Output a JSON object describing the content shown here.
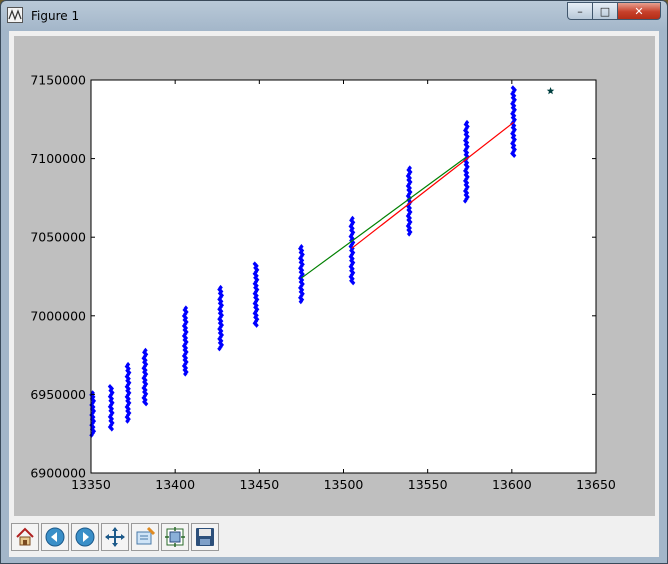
{
  "window": {
    "title": "Figure 1",
    "controls": {
      "minimize": "–",
      "maximize": "□",
      "close": "✕"
    }
  },
  "toolbar": {
    "buttons": [
      {
        "name": "home-button",
        "icon": "home-icon"
      },
      {
        "name": "back-button",
        "icon": "back-arrow-icon"
      },
      {
        "name": "forward-button",
        "icon": "forward-arrow-icon"
      },
      {
        "name": "pan-button",
        "icon": "pan-arrows-icon"
      },
      {
        "name": "zoom-button",
        "icon": "zoom-rect-icon"
      },
      {
        "name": "subplots-button",
        "icon": "subplots-icon"
      },
      {
        "name": "save-button",
        "icon": "save-disk-icon"
      }
    ]
  },
  "chart_data": {
    "type": "scatter",
    "title": "",
    "xlabel": "",
    "ylabel": "",
    "xlim": [
      13350,
      13650
    ],
    "ylim": [
      6900000,
      7150000
    ],
    "x_ticks": [
      13350,
      13400,
      13450,
      13500,
      13550,
      13600,
      13650
    ],
    "y_ticks": [
      6900000,
      6950000,
      7000000,
      7050000,
      7100000,
      7150000
    ],
    "x_tick_labels": [
      "13350",
      "13400",
      "13450",
      "13500",
      "13550",
      "13600",
      "13650"
    ],
    "y_tick_labels": [
      "6900000",
      "6950000",
      "7000000",
      "7050000",
      "7100000",
      "7150000"
    ],
    "grid": false,
    "colors": {
      "points": "#0000ff",
      "green_line": "#008000",
      "red_line": "#ff0000",
      "star": "#003f3f",
      "axes_bg": "#ffffff",
      "figure_bg": "#bfbfbf"
    },
    "scatter_clusters": [
      {
        "x": 13351,
        "ymin": 6924000,
        "ymax": 6951000
      },
      {
        "x": 13362,
        "ymin": 6928000,
        "ymax": 6955000
      },
      {
        "x": 13372,
        "ymin": 6933000,
        "ymax": 6969000
      },
      {
        "x": 13382,
        "ymin": 6944000,
        "ymax": 6978000
      },
      {
        "x": 13406,
        "ymin": 6963000,
        "ymax": 7005000
      },
      {
        "x": 13427,
        "ymin": 6979000,
        "ymax": 7018000
      },
      {
        "x": 13448,
        "ymin": 6994000,
        "ymax": 7033000
      },
      {
        "x": 13475,
        "ymin": 7009000,
        "ymax": 7044000
      },
      {
        "x": 13505,
        "ymin": 7021000,
        "ymax": 7062000
      },
      {
        "x": 13539,
        "ymin": 7052000,
        "ymax": 7094000
      },
      {
        "x": 13573,
        "ymin": 7073000,
        "ymax": 7123000
      },
      {
        "x": 13601,
        "ymin": 7102000,
        "ymax": 7145000
      }
    ],
    "series": [
      {
        "type": "line",
        "color": "#008000",
        "x": [
          13475,
          13573
        ],
        "y": [
          7024000,
          7101000
        ]
      },
      {
        "type": "line",
        "color": "#ff0000",
        "x": [
          13505,
          13601
        ],
        "y": [
          7043000,
          7123000
        ]
      },
      {
        "type": "marker",
        "marker": "star",
        "color": "#003f3f",
        "x": [
          13623
        ],
        "y": [
          7143000
        ]
      }
    ]
  }
}
